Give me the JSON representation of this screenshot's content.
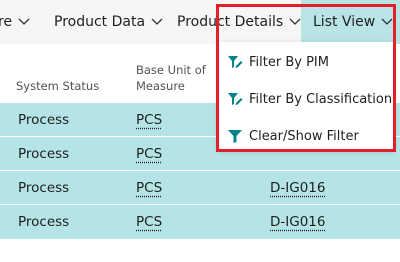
{
  "menubar": {
    "tabs": [
      {
        "label": "re"
      },
      {
        "label": "Product Data"
      },
      {
        "label": "Product Details"
      },
      {
        "label": "List View"
      }
    ]
  },
  "grid": {
    "headers": {
      "system_status": "System Status",
      "base_unit_line1": "Base Unit of",
      "base_unit_line2": "Measure"
    },
    "rows": [
      {
        "status": "Process",
        "unit": "PCS",
        "code": ""
      },
      {
        "status": "Process",
        "unit": "PCS",
        "code": ""
      },
      {
        "status": "Process",
        "unit": "PCS",
        "code": "D-IG016"
      },
      {
        "status": "Process",
        "unit": "PCS",
        "code": "D-IG016"
      }
    ]
  },
  "dropdown": {
    "items": [
      {
        "label": "Filter By PIM",
        "icon": "filter-edit-icon"
      },
      {
        "label": "Filter By Classification",
        "icon": "filter-edit-icon"
      },
      {
        "label": "Clear/Show Filter",
        "icon": "filter-icon"
      }
    ],
    "accent_color": "#008489",
    "highlight_color": "#e3202a"
  }
}
